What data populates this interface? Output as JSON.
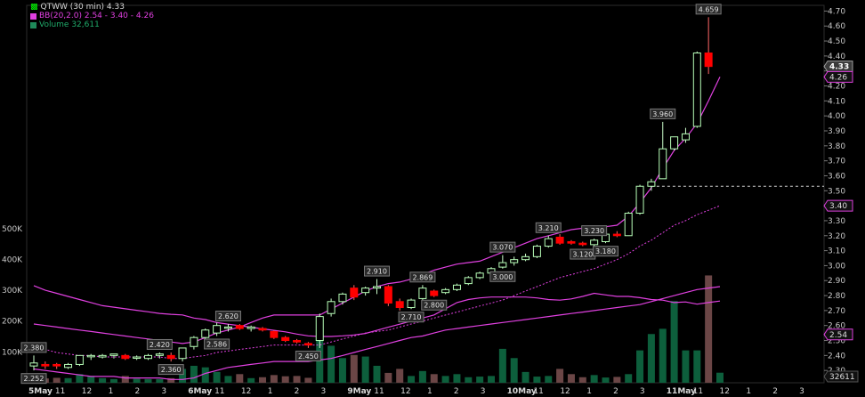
{
  "legend": {
    "symbol_label": "QTWW (30 min) 4.33",
    "bb_label": "BB(20,2.0) 2.54 - 3.40 - 4.26",
    "volume_label": "Volume 32,611"
  },
  "colors": {
    "background": "#000000",
    "up_candle": "#00ff00",
    "down_candle": "#ff0000",
    "bollinger": "#e040e0",
    "volume_up": "#0d5f3c",
    "volume_down": "#6b4646",
    "axis_text": "#c8c8c8",
    "price_tag_bg": "#3a3a3a"
  },
  "chart_data": {
    "type": "candlestick",
    "price_axis": {
      "ylim": [
        2.2,
        4.75
      ],
      "ticks": [
        "2.30",
        "2.40",
        "2.50",
        "2.60",
        "2.70",
        "2.80",
        "2.90",
        "3.00",
        "3.10",
        "3.20",
        "3.30",
        "3.40",
        "3.50",
        "3.60",
        "3.70",
        "3.80",
        "3.90",
        "4.00",
        "4.10",
        "4.20",
        "4.30",
        "4.40",
        "4.50",
        "4.60",
        "4.70"
      ]
    },
    "volume_axis": {
      "ylim": [
        0,
        560000
      ],
      "ticks": [
        "100K",
        "200K",
        "300K",
        "400K",
        "500K"
      ]
    },
    "time_axis": {
      "labels": [
        "5May",
        "11",
        "12",
        "1",
        "2",
        "3",
        "6May",
        "11",
        "12",
        "1",
        "2",
        "3",
        "9May",
        "11",
        "12",
        "1",
        "2",
        "3",
        "10May",
        "11",
        "12",
        "1",
        "2",
        "3",
        "11May",
        "11",
        "12",
        "1",
        "2",
        "3"
      ]
    },
    "candles": [
      {
        "o": 2.33,
        "h": 2.4,
        "l": 2.3,
        "c": 2.35
      },
      {
        "o": 2.34,
        "h": 2.36,
        "l": 2.31,
        "c": 2.33
      },
      {
        "o": 2.34,
        "h": 2.35,
        "l": 2.31,
        "c": 2.33
      },
      {
        "o": 2.32,
        "h": 2.35,
        "l": 2.31,
        "c": 2.34
      },
      {
        "o": 2.34,
        "h": 2.4,
        "l": 2.33,
        "c": 2.4
      },
      {
        "o": 2.4,
        "h": 2.41,
        "l": 2.37,
        "c": 2.4
      },
      {
        "o": 2.39,
        "h": 2.41,
        "l": 2.38,
        "c": 2.4
      },
      {
        "o": 2.4,
        "h": 2.41,
        "l": 2.38,
        "c": 2.41
      },
      {
        "o": 2.4,
        "h": 2.41,
        "l": 2.37,
        "c": 2.38
      },
      {
        "o": 2.39,
        "h": 2.4,
        "l": 2.37,
        "c": 2.39
      },
      {
        "o": 2.38,
        "h": 2.41,
        "l": 2.37,
        "c": 2.4
      },
      {
        "o": 2.4,
        "h": 2.42,
        "l": 2.38,
        "c": 2.41
      },
      {
        "o": 2.4,
        "h": 2.42,
        "l": 2.36,
        "c": 2.38
      },
      {
        "o": 2.38,
        "h": 2.45,
        "l": 2.36,
        "c": 2.45
      },
      {
        "o": 2.46,
        "h": 2.53,
        "l": 2.44,
        "c": 2.52
      },
      {
        "o": 2.52,
        "h": 2.58,
        "l": 2.5,
        "c": 2.57
      },
      {
        "o": 2.55,
        "h": 2.62,
        "l": 2.53,
        "c": 2.6
      },
      {
        "o": 2.59,
        "h": 2.61,
        "l": 2.56,
        "c": 2.59
      },
      {
        "o": 2.6,
        "h": 2.61,
        "l": 2.57,
        "c": 2.58
      },
      {
        "o": 2.58,
        "h": 2.6,
        "l": 2.56,
        "c": 2.59
      },
      {
        "o": 2.58,
        "h": 2.59,
        "l": 2.56,
        "c": 2.57
      },
      {
        "o": 2.56,
        "h": 2.57,
        "l": 2.51,
        "c": 2.52
      },
      {
        "o": 2.52,
        "h": 2.53,
        "l": 2.49,
        "c": 2.5
      },
      {
        "o": 2.5,
        "h": 2.51,
        "l": 2.48,
        "c": 2.49
      },
      {
        "o": 2.48,
        "h": 2.49,
        "l": 2.45,
        "c": 2.47
      },
      {
        "o": 2.5,
        "h": 2.68,
        "l": 2.45,
        "c": 2.66
      },
      {
        "o": 2.68,
        "h": 2.78,
        "l": 2.66,
        "c": 2.76
      },
      {
        "o": 2.76,
        "h": 2.82,
        "l": 2.74,
        "c": 2.81
      },
      {
        "o": 2.85,
        "h": 2.87,
        "l": 2.77,
        "c": 2.79
      },
      {
        "o": 2.82,
        "h": 2.86,
        "l": 2.8,
        "c": 2.85
      },
      {
        "o": 2.85,
        "h": 2.91,
        "l": 2.81,
        "c": 2.86
      },
      {
        "o": 2.86,
        "h": 2.87,
        "l": 2.73,
        "c": 2.75
      },
      {
        "o": 2.76,
        "h": 2.78,
        "l": 2.7,
        "c": 2.72
      },
      {
        "o": 2.72,
        "h": 2.78,
        "l": 2.71,
        "c": 2.77
      },
      {
        "o": 2.78,
        "h": 2.87,
        "l": 2.77,
        "c": 2.85
      },
      {
        "o": 2.83,
        "h": 2.84,
        "l": 2.79,
        "c": 2.8
      },
      {
        "o": 2.82,
        "h": 2.85,
        "l": 2.81,
        "c": 2.84
      },
      {
        "o": 2.84,
        "h": 2.88,
        "l": 2.83,
        "c": 2.87
      },
      {
        "o": 2.88,
        "h": 2.93,
        "l": 2.87,
        "c": 2.92
      },
      {
        "o": 2.92,
        "h": 2.96,
        "l": 2.91,
        "c": 2.95
      },
      {
        "o": 2.95,
        "h": 2.99,
        "l": 2.94,
        "c": 2.98
      },
      {
        "o": 2.99,
        "h": 3.07,
        "l": 2.98,
        "c": 3.02
      },
      {
        "o": 3.02,
        "h": 3.06,
        "l": 3.0,
        "c": 3.04
      },
      {
        "o": 3.04,
        "h": 3.08,
        "l": 3.03,
        "c": 3.06
      },
      {
        "o": 3.06,
        "h": 3.14,
        "l": 3.05,
        "c": 3.13
      },
      {
        "o": 3.13,
        "h": 3.2,
        "l": 3.12,
        "c": 3.18
      },
      {
        "o": 3.19,
        "h": 3.21,
        "l": 3.14,
        "c": 3.15
      },
      {
        "o": 3.16,
        "h": 3.17,
        "l": 3.14,
        "c": 3.15
      },
      {
        "o": 3.15,
        "h": 3.16,
        "l": 3.13,
        "c": 3.14
      },
      {
        "o": 3.14,
        "h": 3.18,
        "l": 3.12,
        "c": 3.17
      },
      {
        "o": 3.16,
        "h": 3.22,
        "l": 3.15,
        "c": 3.21
      },
      {
        "o": 3.21,
        "h": 3.23,
        "l": 3.19,
        "c": 3.2
      },
      {
        "o": 3.2,
        "h": 3.36,
        "l": 3.2,
        "c": 3.35
      },
      {
        "o": 3.35,
        "h": 3.54,
        "l": 3.34,
        "c": 3.53
      },
      {
        "o": 3.53,
        "h": 3.58,
        "l": 3.5,
        "c": 3.56
      },
      {
        "o": 3.58,
        "h": 3.96,
        "l": 3.58,
        "c": 3.78
      },
      {
        "o": 3.78,
        "h": 3.86,
        "l": 3.77,
        "c": 3.86
      },
      {
        "o": 3.84,
        "h": 3.92,
        "l": 3.82,
        "c": 3.88
      },
      {
        "o": 3.93,
        "h": 4.43,
        "l": 3.92,
        "c": 4.42
      },
      {
        "o": 4.42,
        "h": 4.659,
        "l": 4.28,
        "c": 4.33
      }
    ],
    "volume": [
      18000,
      14000,
      16000,
      15000,
      28000,
      22000,
      15000,
      12000,
      22000,
      13000,
      12000,
      12000,
      15000,
      45000,
      55000,
      50000,
      35000,
      22000,
      28000,
      15000,
      18000,
      25000,
      21000,
      22000,
      16000,
      180000,
      120000,
      80000,
      90000,
      85000,
      55000,
      32000,
      45000,
      22000,
      38000,
      28000,
      22000,
      28000,
      18000,
      20000,
      22000,
      110000,
      80000,
      35000,
      20000,
      22000,
      45000,
      28000,
      18000,
      25000,
      17000,
      19000,
      28000,
      105000,
      158000,
      175000,
      265000,
      105000,
      105000,
      348000,
      32611
    ],
    "bb_middle": [
      2.46,
      2.44,
      2.42,
      2.41,
      2.4,
      2.4,
      2.39,
      2.39,
      2.39,
      2.39,
      2.39,
      2.39,
      2.38,
      2.38,
      2.39,
      2.4,
      2.42,
      2.43,
      2.44,
      2.45,
      2.46,
      2.47,
      2.47,
      2.47,
      2.47,
      2.47,
      2.49,
      2.51,
      2.53,
      2.55,
      2.56,
      2.57,
      2.59,
      2.61,
      2.63,
      2.65,
      2.67,
      2.69,
      2.71,
      2.73,
      2.75,
      2.77,
      2.8,
      2.83,
      2.86,
      2.89,
      2.92,
      2.94,
      2.96,
      2.98,
      3.01,
      3.04,
      3.08,
      3.13,
      3.17,
      3.22,
      3.27,
      3.3,
      3.34,
      3.37,
      3.4
    ],
    "bb_upper": [
      2.61,
      2.6,
      2.59,
      2.58,
      2.57,
      2.56,
      2.55,
      2.54,
      2.53,
      2.52,
      2.51,
      2.5,
      2.49,
      2.48,
      2.49,
      2.52,
      2.55,
      2.57,
      2.59,
      2.62,
      2.65,
      2.67,
      2.67,
      2.67,
      2.67,
      2.67,
      2.71,
      2.75,
      2.79,
      2.83,
      2.86,
      2.88,
      2.89,
      2.91,
      2.94,
      2.97,
      2.99,
      3.01,
      3.02,
      3.03,
      3.06,
      3.09,
      3.12,
      3.15,
      3.18,
      3.2,
      3.22,
      3.24,
      3.25,
      3.25,
      3.26,
      3.27,
      3.33,
      3.42,
      3.52,
      3.65,
      3.77,
      3.85,
      3.95,
      4.1,
      4.26
    ],
    "bb_lower": [
      2.31,
      2.3,
      2.29,
      2.28,
      2.27,
      2.26,
      2.26,
      2.26,
      2.25,
      2.25,
      2.25,
      2.25,
      2.24,
      2.24,
      2.25,
      2.28,
      2.3,
      2.32,
      2.33,
      2.34,
      2.35,
      2.36,
      2.36,
      2.36,
      2.36,
      2.37,
      2.38,
      2.4,
      2.42,
      2.44,
      2.46,
      2.48,
      2.5,
      2.52,
      2.53,
      2.55,
      2.57,
      2.58,
      2.59,
      2.6,
      2.61,
      2.62,
      2.63,
      2.64,
      2.65,
      2.66,
      2.67,
      2.68,
      2.69,
      2.7,
      2.71,
      2.72,
      2.73,
      2.74,
      2.76,
      2.78,
      2.8,
      2.82,
      2.84,
      2.85,
      2.86
    ],
    "volume_ma": [
      315000,
      300000,
      290000,
      280000,
      270000,
      260000,
      250000,
      245000,
      240000,
      235000,
      230000,
      225000,
      222000,
      220000,
      210000,
      205000,
      195000,
      190000,
      185000,
      180000,
      175000,
      170000,
      165000,
      158000,
      152000,
      150000,
      150000,
      152000,
      155000,
      160000,
      170000,
      180000,
      190000,
      200000,
      210000,
      220000,
      240000,
      260000,
      270000,
      275000,
      278000,
      278000,
      278000,
      278000,
      275000,
      270000,
      268000,
      272000,
      280000,
      290000,
      285000,
      280000,
      280000,
      276000,
      270000,
      268000,
      260000,
      262000,
      255000,
      260000,
      265000
    ],
    "price_callouts": [
      {
        "i": 0,
        "text": "2.380",
        "side": "above"
      },
      {
        "i": 0,
        "text": "2.252",
        "side": "below"
      },
      {
        "i": 11,
        "text": "2.420",
        "side": "above"
      },
      {
        "i": 12,
        "text": "2.360",
        "side": "below"
      },
      {
        "i": 17,
        "text": "2.620",
        "side": "above"
      },
      {
        "i": 16,
        "text": "2.586",
        "side": "below"
      },
      {
        "i": 24,
        "text": "2.450",
        "side": "below"
      },
      {
        "i": 30,
        "text": "2.910",
        "side": "above"
      },
      {
        "i": 33,
        "text": "2.710",
        "side": "below"
      },
      {
        "i": 34,
        "text": "2.869",
        "side": "above"
      },
      {
        "i": 35,
        "text": "2.800",
        "side": "below"
      },
      {
        "i": 41,
        "text": "3.070",
        "side": "above"
      },
      {
        "i": 41,
        "text": "3.000",
        "side": "below"
      },
      {
        "i": 45,
        "text": "3.210",
        "side": "above"
      },
      {
        "i": 48,
        "text": "3.120",
        "side": "below"
      },
      {
        "i": 49,
        "text": "3.230",
        "side": "above"
      },
      {
        "i": 50,
        "text": "3.180",
        "side": "below"
      },
      {
        "i": 55,
        "text": "3.960",
        "side": "above"
      },
      {
        "i": 59,
        "text": "4.659",
        "side": "above"
      }
    ],
    "dashed_level": 3.53,
    "right_tags": [
      {
        "value": 4.33,
        "text": "4.33",
        "kind": "price"
      },
      {
        "value": 4.26,
        "text": "4.26",
        "kind": "bb"
      },
      {
        "value": 3.4,
        "text": "3.40",
        "kind": "bb"
      },
      {
        "value": 2.54,
        "text": "2.54",
        "kind": "bb"
      },
      {
        "value": 2.2,
        "text": "32611",
        "kind": "volume"
      }
    ]
  }
}
